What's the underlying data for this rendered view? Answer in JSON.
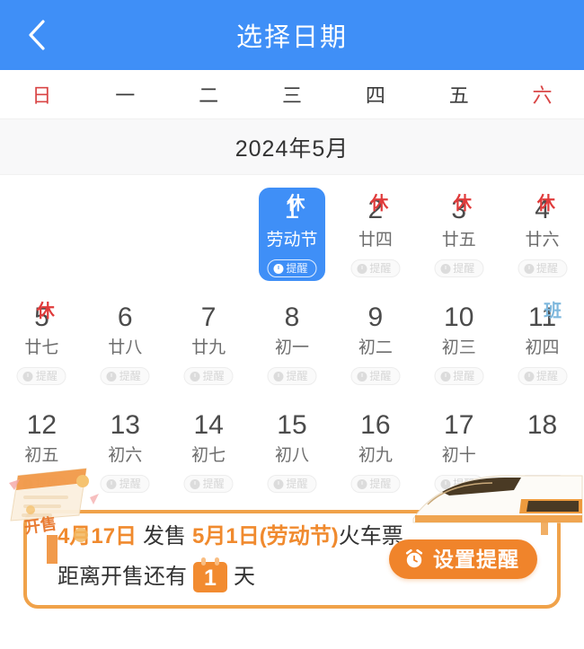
{
  "header": {
    "title": "选择日期",
    "back_icon": "chevron-left-icon",
    "bg_color": "#3F8FF7"
  },
  "weekdays": [
    {
      "label": "日",
      "weekend": true
    },
    {
      "label": "一",
      "weekend": false
    },
    {
      "label": "二",
      "weekend": false
    },
    {
      "label": "三",
      "weekend": false
    },
    {
      "label": "四",
      "weekend": false
    },
    {
      "label": "五",
      "weekend": false
    },
    {
      "label": "六",
      "weekend": true
    }
  ],
  "month": {
    "title": "2024年5月"
  },
  "reminder_pill": {
    "label": "提醒",
    "icon": "alarm-clock-icon"
  },
  "weeks": [
    [
      {
        "empty": true
      },
      {
        "empty": true
      },
      {
        "empty": true
      },
      {
        "day": "1",
        "lunar": "劳动节",
        "mark": "休",
        "mark_type": "rest",
        "selected": true,
        "pill": true
      },
      {
        "day": "2",
        "lunar": "廿四",
        "mark": "休",
        "mark_type": "rest",
        "selected": false,
        "pill": true
      },
      {
        "day": "3",
        "lunar": "廿五",
        "mark": "休",
        "mark_type": "rest",
        "selected": false,
        "pill": true
      },
      {
        "day": "4",
        "lunar": "廿六",
        "mark": "休",
        "mark_type": "rest",
        "selected": false,
        "pill": true
      }
    ],
    [
      {
        "day": "5",
        "lunar": "廿七",
        "mark": "休",
        "mark_type": "rest",
        "selected": false,
        "pill": true
      },
      {
        "day": "6",
        "lunar": "廿八",
        "mark": "",
        "mark_type": "",
        "selected": false,
        "pill": true
      },
      {
        "day": "7",
        "lunar": "廿九",
        "mark": "",
        "mark_type": "",
        "selected": false,
        "pill": true
      },
      {
        "day": "8",
        "lunar": "初一",
        "mark": "",
        "mark_type": "",
        "selected": false,
        "pill": true
      },
      {
        "day": "9",
        "lunar": "初二",
        "mark": "",
        "mark_type": "",
        "selected": false,
        "pill": true
      },
      {
        "day": "10",
        "lunar": "初三",
        "mark": "",
        "mark_type": "",
        "selected": false,
        "pill": true
      },
      {
        "day": "11",
        "lunar": "初四",
        "mark": "班",
        "mark_type": "work",
        "selected": false,
        "pill": true
      }
    ],
    [
      {
        "day": "12",
        "lunar": "初五",
        "mark": "",
        "mark_type": "",
        "selected": false,
        "pill": true
      },
      {
        "day": "13",
        "lunar": "初六",
        "mark": "",
        "mark_type": "",
        "selected": false,
        "pill": true
      },
      {
        "day": "14",
        "lunar": "初七",
        "mark": "",
        "mark_type": "",
        "selected": false,
        "pill": true
      },
      {
        "day": "15",
        "lunar": "初八",
        "mark": "",
        "mark_type": "",
        "selected": false,
        "pill": true
      },
      {
        "day": "16",
        "lunar": "初九",
        "mark": "",
        "mark_type": "",
        "selected": false,
        "pill": true
      },
      {
        "day": "17",
        "lunar": "初十",
        "mark": "",
        "mark_type": "",
        "selected": false,
        "pill": true
      },
      {
        "day": "18",
        "lunar": "",
        "mark": "",
        "mark_type": "",
        "selected": false,
        "pill": true
      }
    ]
  ],
  "promo": {
    "line1": {
      "sale_date": "4月17日",
      "verb": "发售",
      "target_date": "5月1日(劳动节)",
      "object": "火车票,"
    },
    "line2": {
      "prefix": "距离开售还有",
      "days": "1",
      "suffix": "天"
    },
    "button": {
      "label": "设置提醒",
      "icon": "alarm-clock-icon",
      "color": "#F0842B"
    },
    "border_color": "#F0A24A",
    "ticket_icon_text": "开售",
    "train_icon": "high-speed-train-icon"
  }
}
